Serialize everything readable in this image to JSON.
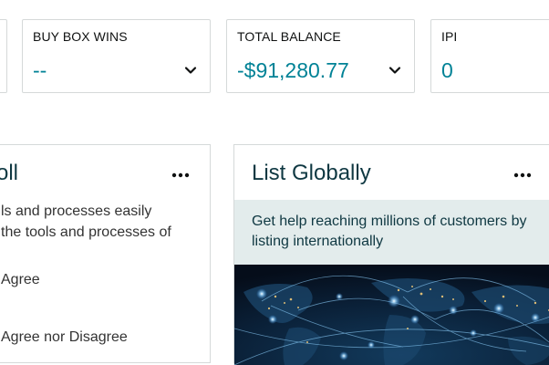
{
  "metrics": [
    {
      "label": "BUY BOX WINS",
      "value": "--"
    },
    {
      "label": "TOTAL BALANCE",
      "value": "-$91,280.77"
    },
    {
      "label": "IPI",
      "value": "0"
    }
  ],
  "poll_card": {
    "title_fragment": "oll",
    "text_line_1": "ls and processes easily",
    "text_line_2": "the tools and processes of",
    "option_1": "Agree",
    "option_2": "Agree nor Disagree"
  },
  "list_globally_card": {
    "title": "List Globally",
    "description": "Get help reaching millions of customers by listing internationally"
  },
  "colors": {
    "accent_teal": "#008296",
    "title_dark_teal": "#0f3842",
    "banner_bg": "#e3ecec",
    "border": "#d5d9d9"
  }
}
